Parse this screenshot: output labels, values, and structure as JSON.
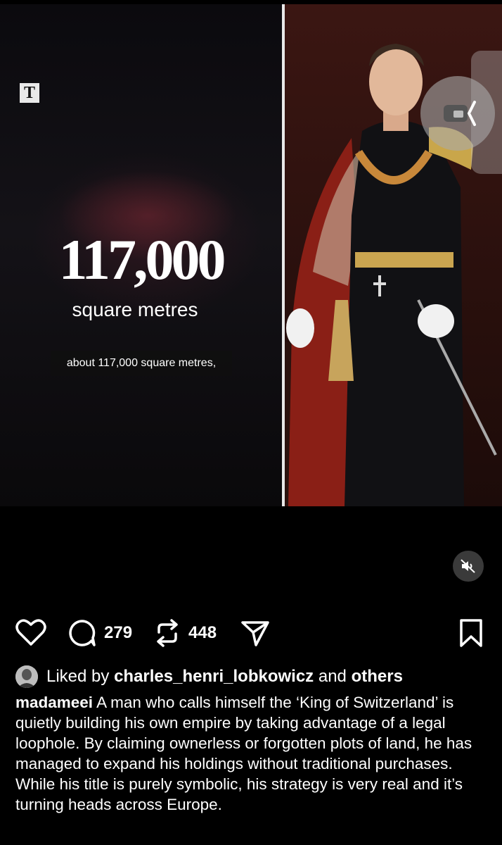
{
  "video": {
    "logo_letter": "T",
    "headline_number": "117,000",
    "headline_unit": "square metres",
    "subtitle": "about 117,000 square metres,"
  },
  "post_actions": {
    "like_icon": "heart-icon",
    "comment_count": "279",
    "repost_count": "448",
    "share_icon": "paper-plane-icon",
    "save_icon": "bookmark-icon"
  },
  "likes": {
    "prefix": "Liked by",
    "user": "charles_henri_lobkowicz",
    "middle": "and",
    "others": "others"
  },
  "caption": {
    "username": "madameei",
    "text": "A man who calls himself the ‘King of Switzerland’ is quietly building his own empire by taking advantage of a legal loophole. By claiming ownerless or forgotten plots of land, he has managed to expand his holdings without traditional purchases. While his title is purely symbolic, his strategy is very real and it’s turning heads across Europe."
  },
  "colors": {
    "background": "#000000",
    "text": "#ffffff",
    "divider": "#e8e8e8"
  }
}
